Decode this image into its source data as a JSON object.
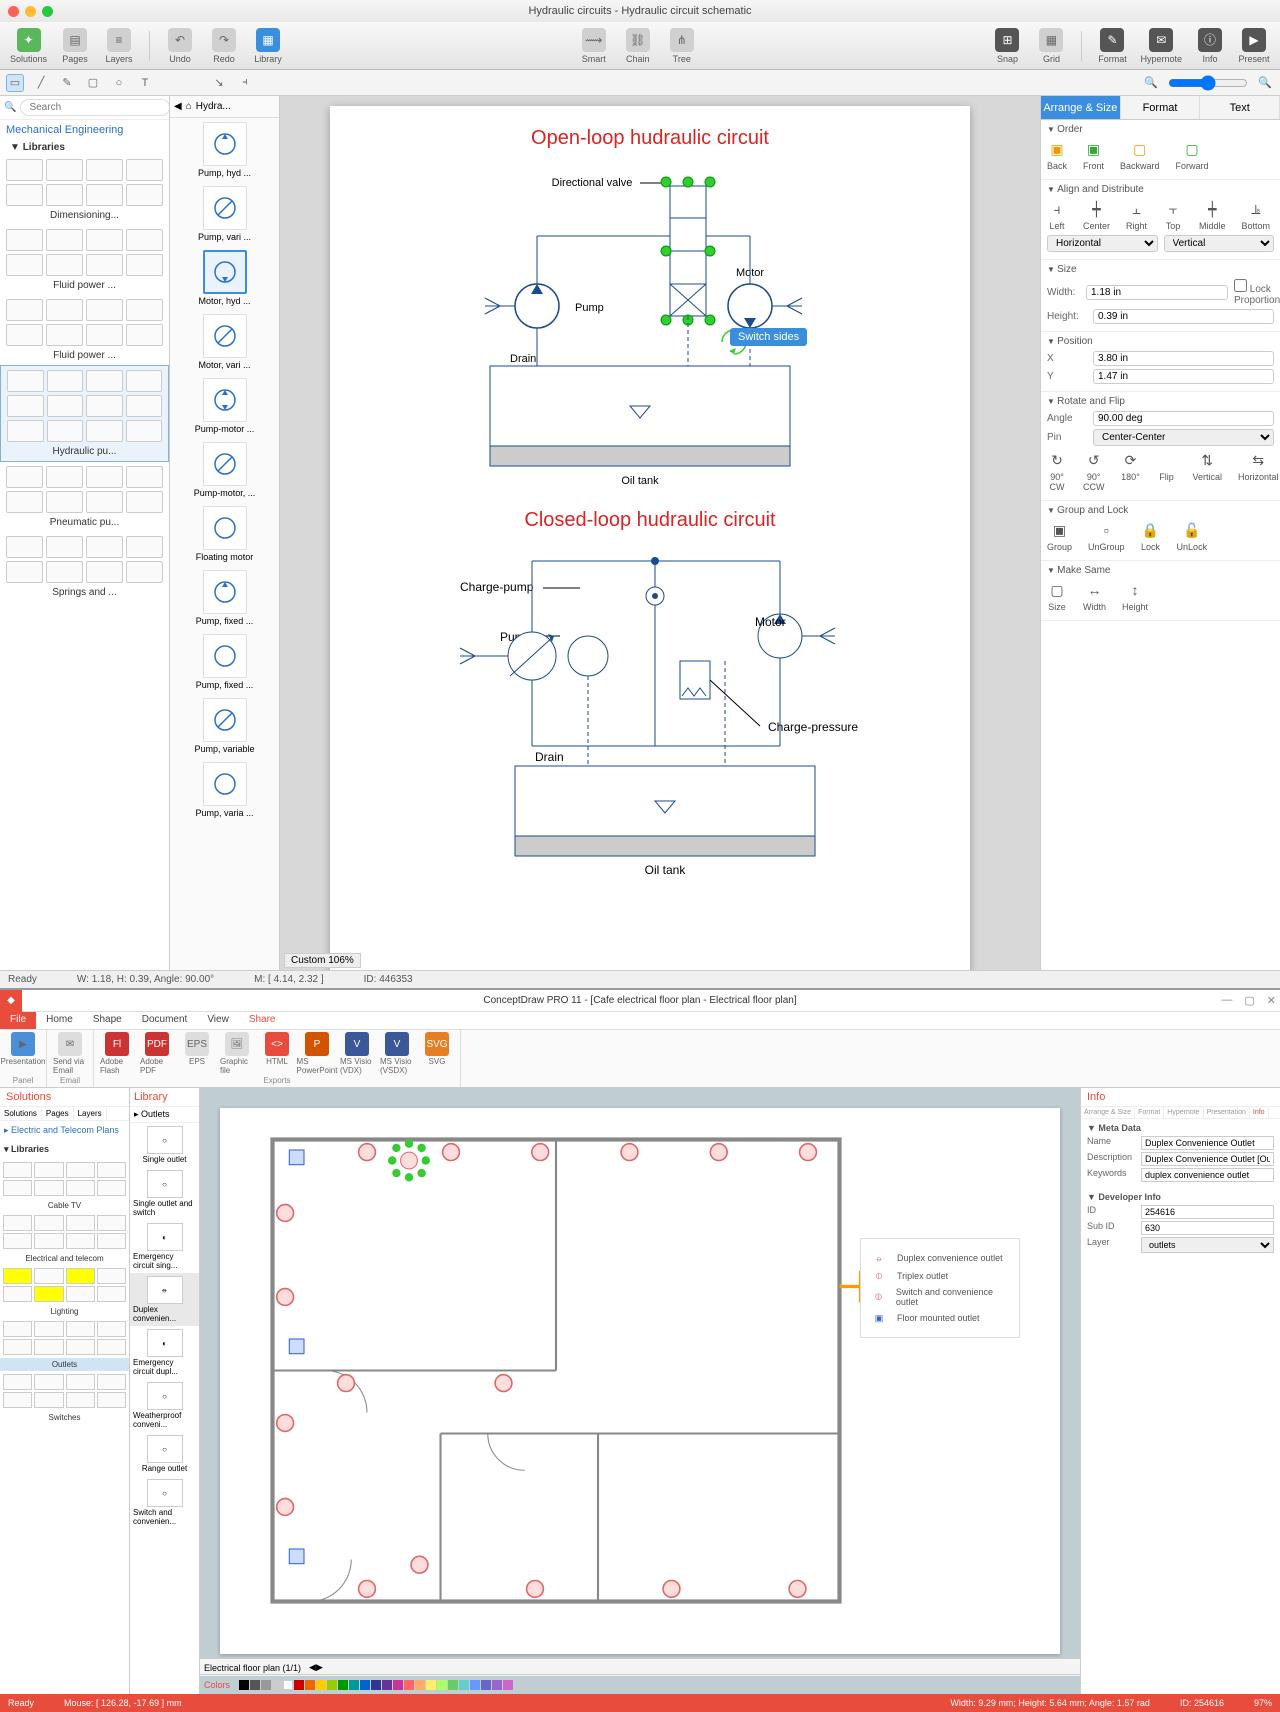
{
  "app1": {
    "title": "Hydraulic circuits - Hydraulic circuit schematic",
    "toolbar": {
      "solutions": "Solutions",
      "pages": "Pages",
      "layers": "Layers",
      "undo": "Undo",
      "redo": "Redo",
      "library": "Library",
      "smart": "Smart",
      "chain": "Chain",
      "tree": "Tree",
      "snap": "Snap",
      "grid": "Grid",
      "format": "Format",
      "hypernote": "Hypernote",
      "info": "Info",
      "present": "Present"
    },
    "search_placeholder": "Search",
    "left": {
      "heading": "Mechanical Engineering",
      "libraries": "Libraries",
      "groups": [
        "Dimensioning...",
        "Fluid power ...",
        "Fluid power ...",
        "Hydraulic pu...",
        "Pneumatic pu...",
        "Springs and ..."
      ]
    },
    "shapelib": {
      "tab": "Hydra...",
      "items": [
        "Pump, hyd ...",
        "Pump, vari ...",
        "Motor, hyd ...",
        "Motor, vari ...",
        "Pump-motor ...",
        "Pump-motor, ...",
        "Floating motor",
        "Pump, fixed ...",
        "Pump, fixed ...",
        "Pump, variable",
        "Pump, varia ..."
      ]
    },
    "canvas": {
      "title1": "Open-loop hudraulic circuit",
      "title2": "Closed-loop hudraulic circuit",
      "labels": {
        "dirvalve": "Directional valve",
        "pump": "Pump",
        "motor": "Motor",
        "drain": "Drain",
        "oiltank": "Oil tank",
        "chargepump": "Charge-pump",
        "chargepress": "Charge-pressure"
      },
      "tooltip": "Switch sides",
      "zoom": "Custom 106%"
    },
    "right": {
      "tabs": {
        "arrange": "Arrange & Size",
        "format": "Format",
        "text": "Text"
      },
      "order": {
        "h": "Order",
        "back": "Back",
        "front": "Front",
        "backward": "Backward",
        "forward": "Forward"
      },
      "align": {
        "h": "Align and Distribute",
        "left": "Left",
        "center": "Center",
        "right": "Right",
        "top": "Top",
        "middle": "Middle",
        "bottom": "Bottom",
        "horiz": "Horizontal",
        "vert": "Vertical"
      },
      "size": {
        "h": "Size",
        "wl": "Width:",
        "wv": "1.18 in",
        "hl": "Height:",
        "hv": "0.39 in",
        "lock": "Lock Proportions"
      },
      "pos": {
        "h": "Position",
        "xl": "X",
        "xv": "3.80 in",
        "yl": "Y",
        "yv": "1.47 in"
      },
      "rot": {
        "h": "Rotate and Flip",
        "al": "Angle",
        "av": "90.00 deg",
        "pl": "Pin",
        "pv": "Center-Center",
        "cw": "90° CW",
        "ccw": "90° CCW",
        "r180": "180°",
        "flip": "Flip",
        "vert": "Vertical",
        "horiz": "Horizontal"
      },
      "grp": {
        "h": "Group and Lock",
        "group": "Group",
        "ungroup": "UnGroup",
        "lock": "Lock",
        "unlock": "UnLock"
      },
      "same": {
        "h": "Make Same",
        "size": "Size",
        "width": "Width",
        "height": "Height"
      }
    },
    "status": {
      "ready": "Ready",
      "wh": "W: 1.18,  H: 0.39,  Angle: 90.00°",
      "m": "M: [ 4.14, 2.32 ]",
      "id": "ID: 446353"
    }
  },
  "app2": {
    "title": "ConceptDraw PRO 11 - [Cafe electrical floor plan - Electrical floor plan]",
    "tabs": {
      "file": "File",
      "home": "Home",
      "shape": "Shape",
      "document": "Document",
      "view": "View",
      "share": "Share"
    },
    "ribbon": {
      "presentation": "Presentation",
      "email": "Send via Email",
      "flash": "Adobe Flash",
      "pdf": "Adobe PDF",
      "eps": "EPS",
      "gfile": "Graphic file",
      "html": "HTML",
      "ppt": "MS PowerPoint",
      "vdx": "MS Visio (VDX)",
      "vsdx": "MS Visio (VSDX)",
      "svg": "SVG",
      "g_panel": "Panel",
      "g_email": "Email",
      "g_exports": "Exports"
    },
    "sol": {
      "h": "Solutions",
      "tabs": [
        "Solutions",
        "Pages",
        "Layers"
      ],
      "tree": "Electric and Telecom Plans",
      "lib": "Libraries",
      "groups": [
        "Cable TV",
        "Electrical and telecom",
        "Lighting",
        "Outlets",
        "Switches"
      ]
    },
    "lib": {
      "h": "Library",
      "tab": "Outlets",
      "items": [
        "Single outlet",
        "Single outlet and switch",
        "Emergency circuit sing...",
        "Duplex convenien...",
        "Emergency circuit dupl...",
        "Weatherproof conveni...",
        "Range outlet",
        "Switch and convenien..."
      ]
    },
    "legend": {
      "duplex": "Duplex convenience outlet",
      "triplex": "Triplex outlet",
      "switch": "Switch and convenience outlet",
      "floor": "Floor mounted outlet"
    },
    "info": {
      "h": "Info",
      "tabs": [
        "Arrange & Size",
        "Format",
        "Hypernote",
        "Presentation",
        "Info"
      ],
      "meta": {
        "h": "Meta Data",
        "name_l": "Name",
        "name_v": "Duplex Convenience Outlet",
        "desc_l": "Description",
        "desc_v": "Duplex Convenience Outlet [Outlets.cdl]",
        "kw_l": "Keywords",
        "kw_v": "duplex convenience outlet"
      },
      "dev": {
        "h": "Developer Info",
        "id_l": "ID",
        "id_v": "254616",
        "sub_l": "Sub ID",
        "sub_v": "630",
        "layer_l": "Layer",
        "layer_v": "outlets"
      }
    },
    "colors_h": "Colors",
    "tabbar": "Electrical floor plan (1/1)",
    "status": {
      "ready": "Ready",
      "mouse": "Mouse: [ 126.28, -17.69 ] mm",
      "dims": "Width: 9.29 mm;  Height: 5.64 mm;  Angle: 1.57 rad",
      "id": "ID: 254616",
      "zoom": "97%"
    }
  }
}
